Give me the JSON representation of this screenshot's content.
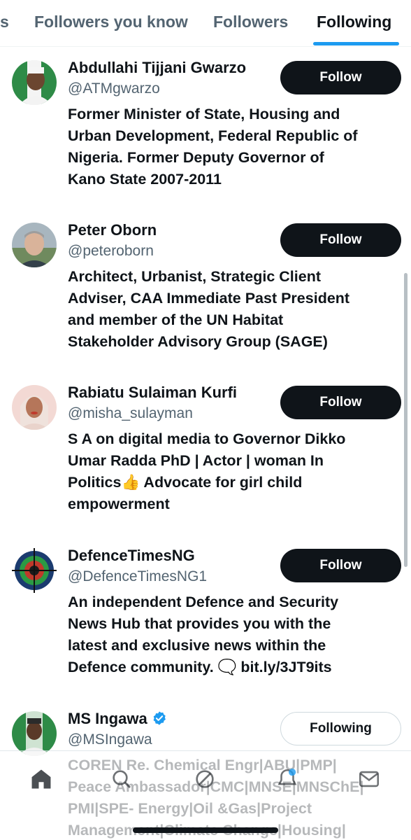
{
  "tabs": [
    {
      "label": "s"
    },
    {
      "label": "Followers you know"
    },
    {
      "label": "Followers"
    },
    {
      "label": "Following",
      "active": true
    }
  ],
  "colors": {
    "accent": "#1d9bf0",
    "text_primary": "#0f1419",
    "text_secondary": "#536471",
    "button_dark": "#0f1419"
  },
  "users": [
    {
      "name": "Abdullahi Tijjani Gwarzo",
      "handle": "@ATMgwarzo",
      "button": "Follow",
      "bio": [
        "Former Minister of State, Housing and",
        "Urban Development, Federal Republic of",
        "Nigeria. Former Deputy Governor of",
        "Kano State 2007-2011"
      ]
    },
    {
      "name": "Peter Oborn",
      "handle": "@peteroborn",
      "button": "Follow",
      "bio": [
        "Architect, Urbanist, Strategic Client",
        "Adviser, CAA Immediate Past President",
        "and member of the UN Habitat",
        "Stakeholder Advisory Group (SAGE)"
      ]
    },
    {
      "name": "Rabiatu Sulaiman Kurfi",
      "handle": "@misha_sulayman",
      "button": "Follow",
      "bio": [
        "S A on digital media to Governor Dikko",
        "Umar Radda PhD | Actor | woman In",
        "Politics👍 Advocate for girl child",
        "empowerment"
      ]
    },
    {
      "name": "DefenceTimesNG",
      "handle": "@DefenceTimesNG1",
      "button": "Follow",
      "bio": [
        "An independent Defence and Security",
        "News Hub that provides you with the",
        "latest and exclusive news within the",
        "Defence community. 🗨️ bit.ly/3JT9its"
      ]
    },
    {
      "name": "MS Ingawa",
      "handle": "@MSIngawa",
      "button": "Following",
      "verified": true,
      "bio": [
        "COREN Re. Chemical Engr|ABU|PMP|",
        "Peace Ambassador|CMC|MNSE|MNSChE|",
        "PMI|SPE- Energy|Oil &Gas|Project",
        "Management|Climate Change|Housing|"
      ]
    }
  ],
  "bottom_nav": [
    "home-icon",
    "search-icon",
    "grok-icon",
    "notifications-icon",
    "messages-icon"
  ]
}
